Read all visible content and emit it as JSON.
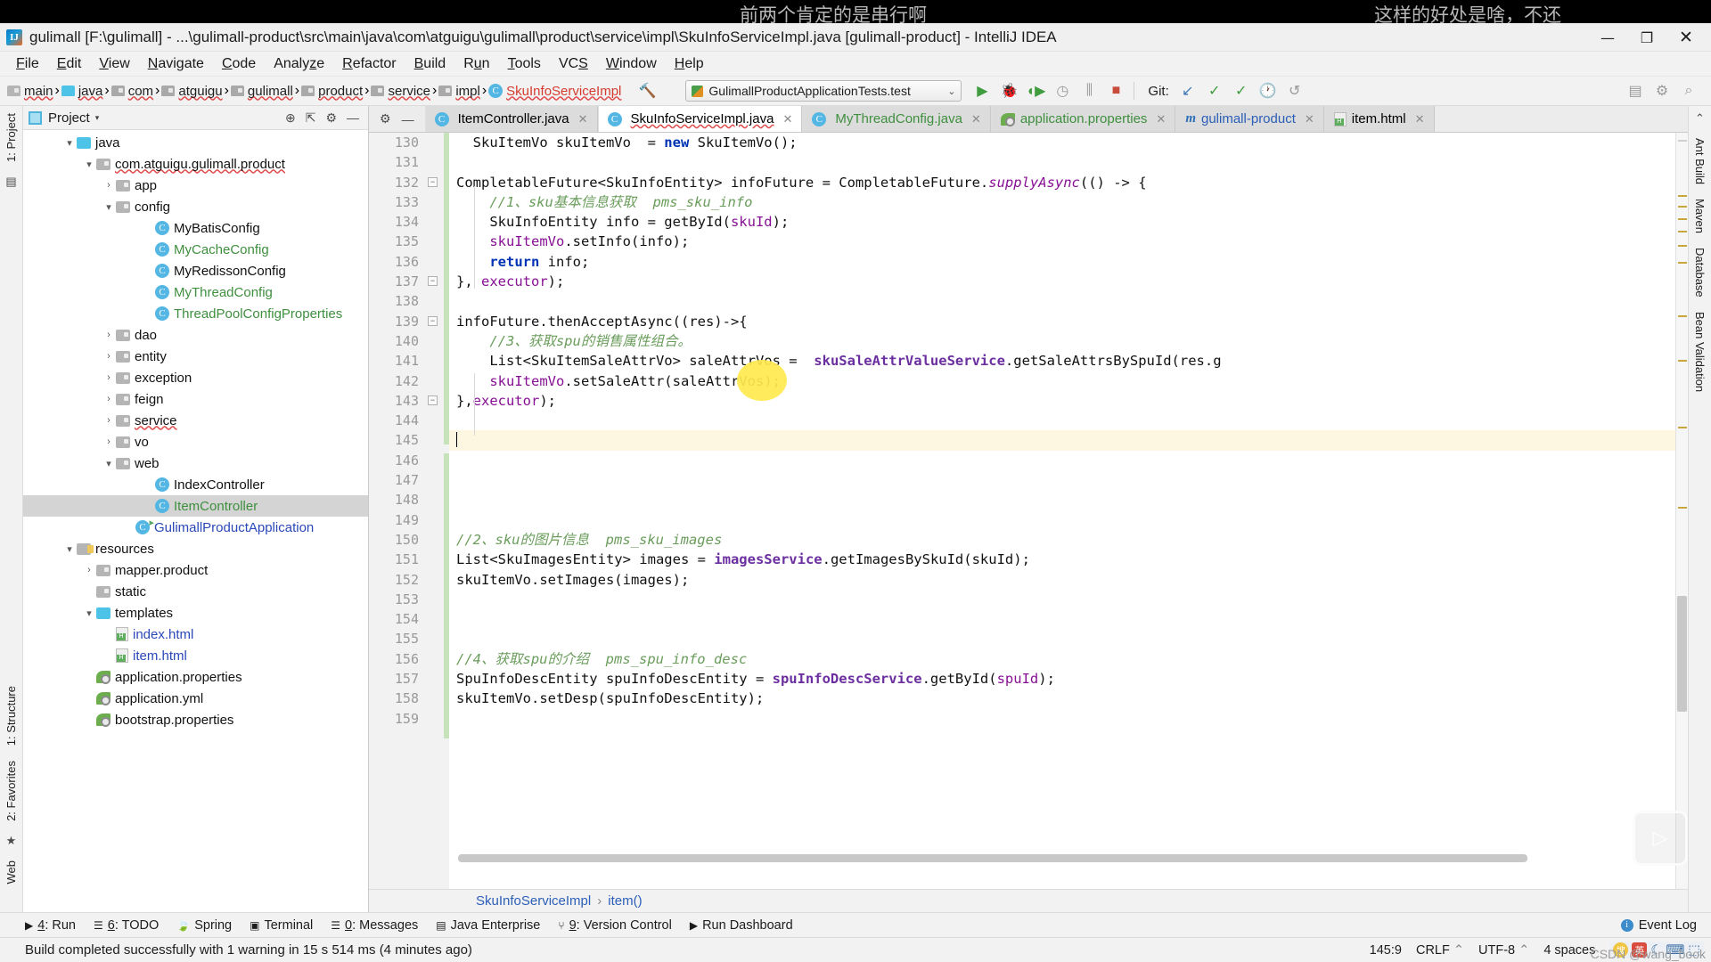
{
  "overlay": {
    "caption_left": "前两个肯定的是串行啊",
    "caption_right": "这样的好处是啥，不还",
    "watermark": "CSDN @wang_book",
    "play_icon": "play-triangle-icon"
  },
  "window": {
    "title": "gulimall [F:\\gulimall] - ...\\gulimall-product\\src\\main\\java\\com\\atguigu\\gulimall\\product\\service\\impl\\SkuInfoServiceImpl.java [gulimall-product] - IntelliJ IDEA",
    "logo": "IJ",
    "minimize": "—",
    "maximize": "❐",
    "close": "✕"
  },
  "menu": [
    {
      "pre": "",
      "mn": "F",
      "post": "ile"
    },
    {
      "pre": "",
      "mn": "E",
      "post": "dit"
    },
    {
      "pre": "",
      "mn": "V",
      "post": "iew"
    },
    {
      "pre": "",
      "mn": "N",
      "post": "avigate"
    },
    {
      "pre": "",
      "mn": "C",
      "post": "ode"
    },
    {
      "pre": "Analy",
      "mn": "z",
      "post": "e"
    },
    {
      "pre": "",
      "mn": "R",
      "post": "efactor"
    },
    {
      "pre": "",
      "mn": "B",
      "post": "uild"
    },
    {
      "pre": "R",
      "mn": "u",
      "post": "n"
    },
    {
      "pre": "",
      "mn": "T",
      "post": "ools"
    },
    {
      "pre": "VC",
      "mn": "S",
      "post": ""
    },
    {
      "pre": "",
      "mn": "W",
      "post": "indow"
    },
    {
      "pre": "",
      "mn": "H",
      "post": "elp"
    }
  ],
  "navbar": {
    "breadcrumbs": [
      {
        "label": "main",
        "icon": "folder-icon",
        "kind": "folder-gray"
      },
      {
        "label": "java",
        "icon": "folder-icon",
        "kind": "folder-blue"
      },
      {
        "label": "com",
        "icon": "package-icon",
        "kind": "folder-gray2"
      },
      {
        "label": "atguigu",
        "icon": "package-icon",
        "kind": "folder-gray2"
      },
      {
        "label": "gulimall",
        "icon": "package-icon",
        "kind": "folder-gray2"
      },
      {
        "label": "product",
        "icon": "package-icon",
        "kind": "folder-gray2"
      },
      {
        "label": "service",
        "icon": "package-icon",
        "kind": "folder-gray2"
      },
      {
        "label": "impl",
        "icon": "package-icon",
        "kind": "folder-gray2"
      },
      {
        "label": "SkuInfoServiceImpl",
        "icon": "class-icon",
        "kind": "class"
      }
    ],
    "build_icon": "hammer-icon",
    "run_config": "GulimallProductApplicationTests.test",
    "run_config_chevron": "⌄",
    "icons": [
      {
        "name": "run-icon",
        "glyph": "▶",
        "color": "green"
      },
      {
        "name": "debug-icon",
        "glyph": "🐞",
        "color": "green"
      },
      {
        "name": "run-with-coverage-icon",
        "glyph": "◖▶",
        "color": "green"
      },
      {
        "name": "profile-icon",
        "glyph": "◷",
        "color": "gray"
      },
      {
        "name": "attach-process-icon",
        "glyph": "⫼",
        "color": "gray"
      },
      {
        "name": "stop-icon",
        "glyph": "■",
        "color": "red"
      }
    ],
    "git_label": "Git:",
    "git_icons": [
      {
        "name": "update-project-icon",
        "glyph": "↙",
        "color": "blue"
      },
      {
        "name": "commit-icon",
        "glyph": "✓",
        "color": "green"
      },
      {
        "name": "push-icon",
        "glyph": "✓",
        "color": "green"
      },
      {
        "name": "history-icon",
        "glyph": "🕐",
        "color": "gray"
      },
      {
        "name": "rollback-icon",
        "glyph": "↺",
        "color": "gray"
      }
    ],
    "right_icons": [
      {
        "name": "project-structure-icon",
        "glyph": "▤"
      },
      {
        "name": "settings-icon",
        "glyph": "⚙"
      },
      {
        "name": "search-everywhere-icon",
        "glyph": "⌕"
      }
    ]
  },
  "left_rail": [
    {
      "label": "1: Project",
      "name": "rail-tab-project"
    },
    {
      "label": "1: Structure",
      "name": "rail-tab-structure"
    },
    {
      "label": "2: Favorites",
      "name": "rail-tab-favorites"
    },
    {
      "label": "Web",
      "name": "rail-tab-web"
    }
  ],
  "right_rail": [
    {
      "label": "Ant Build",
      "name": "rail-tab-ant-build"
    },
    {
      "label": "Maven",
      "name": "rail-tab-maven"
    },
    {
      "label": "Database",
      "name": "rail-tab-database"
    },
    {
      "label": "Bean Validation",
      "name": "rail-tab-bean-validation"
    }
  ],
  "project_panel": {
    "title": "Project",
    "caret": "▾",
    "actions": [
      {
        "name": "locate-icon",
        "glyph": "⊕"
      },
      {
        "name": "collapse-all-icon",
        "glyph": "⇱"
      },
      {
        "name": "settings-gear-icon",
        "glyph": "⚙"
      },
      {
        "name": "hide-icon",
        "glyph": "—"
      }
    ],
    "tree": [
      {
        "indent": 2,
        "arrow": "▾",
        "icon": "folder-blue",
        "label": "java",
        "color": "dark",
        "selected": false
      },
      {
        "indent": 3,
        "arrow": "▾",
        "icon": "package",
        "label": "com.atguigu.gulimall.product",
        "color": "dark",
        "selected": false,
        "spell": true
      },
      {
        "indent": 4,
        "arrow": "›",
        "icon": "package",
        "label": "app",
        "color": "dark",
        "selected": false
      },
      {
        "indent": 4,
        "arrow": "▾",
        "icon": "package",
        "label": "config",
        "color": "dark",
        "selected": false
      },
      {
        "indent": 6,
        "arrow": "",
        "icon": "class",
        "label": "MyBatisConfig",
        "color": "dark",
        "selected": false
      },
      {
        "indent": 6,
        "arrow": "",
        "icon": "class",
        "label": "MyCacheConfig",
        "color": "green",
        "selected": false
      },
      {
        "indent": 6,
        "arrow": "",
        "icon": "class",
        "label": "MyRedissonConfig",
        "color": "dark",
        "selected": false
      },
      {
        "indent": 6,
        "arrow": "",
        "icon": "class",
        "label": "MyThreadConfig",
        "color": "green",
        "selected": false
      },
      {
        "indent": 6,
        "arrow": "",
        "icon": "class",
        "label": "ThreadPoolConfigProperties",
        "color": "green",
        "selected": false
      },
      {
        "indent": 4,
        "arrow": "›",
        "icon": "package",
        "label": "dao",
        "color": "dark",
        "selected": false
      },
      {
        "indent": 4,
        "arrow": "›",
        "icon": "package",
        "label": "entity",
        "color": "dark",
        "selected": false
      },
      {
        "indent": 4,
        "arrow": "›",
        "icon": "package",
        "label": "exception",
        "color": "dark",
        "selected": false
      },
      {
        "indent": 4,
        "arrow": "›",
        "icon": "package",
        "label": "feign",
        "color": "dark",
        "selected": false
      },
      {
        "indent": 4,
        "arrow": "›",
        "icon": "package",
        "label": "service",
        "color": "dark",
        "selected": false,
        "spell": true
      },
      {
        "indent": 4,
        "arrow": "›",
        "icon": "package",
        "label": "vo",
        "color": "dark",
        "selected": false
      },
      {
        "indent": 4,
        "arrow": "▾",
        "icon": "package",
        "label": "web",
        "color": "dark",
        "selected": false
      },
      {
        "indent": 6,
        "arrow": "",
        "icon": "class",
        "label": "IndexController",
        "color": "dark",
        "selected": false
      },
      {
        "indent": 6,
        "arrow": "",
        "icon": "class",
        "label": "ItemController",
        "color": "green",
        "selected": true
      },
      {
        "indent": 5,
        "arrow": "",
        "icon": "class-runnable",
        "label": "GulimallProductApplication",
        "color": "blue",
        "selected": false
      },
      {
        "indent": 2,
        "arrow": "▾",
        "icon": "resources",
        "label": "resources",
        "color": "dark",
        "selected": false
      },
      {
        "indent": 3,
        "arrow": "›",
        "icon": "package",
        "label": "mapper.product",
        "color": "dark",
        "selected": false
      },
      {
        "indent": 3,
        "arrow": "",
        "icon": "package",
        "label": "static",
        "color": "dark",
        "selected": false
      },
      {
        "indent": 3,
        "arrow": "▾",
        "icon": "folder-blue-small",
        "label": "templates",
        "color": "dark",
        "selected": false
      },
      {
        "indent": 4,
        "arrow": "",
        "icon": "html",
        "label": "index.html",
        "color": "blue",
        "selected": false
      },
      {
        "indent": 4,
        "arrow": "",
        "icon": "html",
        "label": "item.html",
        "color": "blue",
        "selected": false
      },
      {
        "indent": 3,
        "arrow": "",
        "icon": "properties",
        "label": "application.properties",
        "color": "dark",
        "selected": false
      },
      {
        "indent": 3,
        "arrow": "",
        "icon": "properties",
        "label": "application.yml",
        "color": "dark",
        "selected": false
      },
      {
        "indent": 3,
        "arrow": "",
        "icon": "properties",
        "label": "bootstrap.properties",
        "color": "dark",
        "selected": false
      }
    ]
  },
  "editor": {
    "tools": [
      {
        "name": "settings-gear-icon",
        "glyph": "⚙"
      },
      {
        "name": "hide-panel-icon",
        "glyph": "—"
      }
    ],
    "tabs": [
      {
        "label": "ItemController.java",
        "icon": "java-class-icon",
        "active": false,
        "closable": true,
        "color": "dark"
      },
      {
        "label": "SkuInfoServiceImpl.java",
        "icon": "java-class-icon",
        "active": true,
        "closable": true,
        "color": "dark",
        "spell": true
      },
      {
        "label": "MyThreadConfig.java",
        "icon": "java-class-icon",
        "active": false,
        "closable": true,
        "color": "green"
      },
      {
        "label": "application.properties",
        "icon": "properties-icon",
        "active": false,
        "closable": true,
        "color": "green"
      },
      {
        "label": "gulimall-product",
        "icon": "maven-icon",
        "active": false,
        "closable": true,
        "color": "blue"
      },
      {
        "label": "item.html",
        "icon": "html-icon",
        "active": false,
        "closable": true,
        "color": "dark"
      }
    ],
    "first_line_number": 130,
    "lines": [
      {
        "n": 130,
        "marks": "",
        "fold": "",
        "html": "<span class=\"plain\">  SkuItemVo skuItemVo  = </span><span class=\"kw\">new</span><span class=\"plain\"> SkuItemVo();</span>",
        "partial": true
      },
      {
        "n": 131,
        "marks": "",
        "fold": "",
        "html": ""
      },
      {
        "n": 132,
        "marks": "lambda",
        "fold": "minus",
        "html": "<span class=\"plain\">CompletableFuture&lt;SkuInfoEntity&gt; infoFuture = CompletableFuture.</span><span class=\"stat\">supplyAsync</span><span class=\"plain\">(() -&gt; {</span>"
      },
      {
        "n": 133,
        "marks": "",
        "fold": "",
        "html": "<span class=\"cmt-green\">    //1、sku基本信息获取  pms_sku_info</span>"
      },
      {
        "n": 134,
        "marks": "",
        "fold": "",
        "html": "<span class=\"plain\">    SkuInfoEntity info = getById(</span><span class=\"fld\">skuId</span><span class=\"plain\">);</span>"
      },
      {
        "n": 135,
        "marks": "",
        "fold": "",
        "html": "<span class=\"fld\">    skuItemVo</span><span class=\"plain\">.setInfo(info);</span>"
      },
      {
        "n": 136,
        "marks": "",
        "fold": "",
        "html": "<span class=\"kw\">    return</span><span class=\"plain\"> info;</span>"
      },
      {
        "n": 137,
        "marks": "",
        "fold": "minus",
        "html": "<span class=\"plain\">}, </span><span class=\"fld\">executor</span><span class=\"plain\">);</span>"
      },
      {
        "n": 138,
        "marks": "",
        "fold": "",
        "html": ""
      },
      {
        "n": 139,
        "marks": "lambda",
        "fold": "minus",
        "html": "<span class=\"plain\">infoFuture.thenAcceptAsync((res)-&gt;{</span>"
      },
      {
        "n": 140,
        "marks": "",
        "fold": "",
        "html": "<span class=\"cmt-green\">    //3、获取spu的销售属性组合。</span>"
      },
      {
        "n": 141,
        "marks": "",
        "fold": "",
        "html": "<span class=\"plain\">    List&lt;SkuItemSaleAttrVo&gt; saleAttrVos =  </span><span class=\"svc\">skuSaleAttrValueService</span><span class=\"plain\">.getSaleAttrsBySpuId(res.g</span>"
      },
      {
        "n": 142,
        "marks": "",
        "fold": "",
        "html": "<span class=\"fld\">    skuItemVo</span><span class=\"plain\">.setSaleAttr(saleAttrVos);</span>"
      },
      {
        "n": 143,
        "marks": "",
        "fold": "minus",
        "html": "<span class=\"plain\">},</span><span class=\"fld\">executor</span><span class=\"plain\">);</span>"
      },
      {
        "n": 144,
        "marks": "",
        "fold": "",
        "html": ""
      },
      {
        "n": 145,
        "marks": "",
        "fold": "",
        "html": "<span class=\"caret\"></span>",
        "caret": true
      },
      {
        "n": 146,
        "marks": "",
        "fold": "",
        "html": ""
      },
      {
        "n": 147,
        "marks": "",
        "fold": "",
        "html": ""
      },
      {
        "n": 148,
        "marks": "",
        "fold": "",
        "html": ""
      },
      {
        "n": 149,
        "marks": "",
        "fold": "",
        "html": ""
      },
      {
        "n": 150,
        "marks": "",
        "fold": "",
        "html": "<span class=\"cmt-green\">//2、sku的图片信息  pms_sku_images</span>"
      },
      {
        "n": 151,
        "marks": "",
        "fold": "",
        "html": "<span class=\"plain\">List&lt;SkuImagesEntity&gt; images = </span><span class=\"svc\">imagesService</span><span class=\"plain\">.getImagesBySkuId(skuId);</span>"
      },
      {
        "n": 152,
        "marks": "",
        "fold": "",
        "html": "<span class=\"plain\">skuItemVo.setImages(images);</span>"
      },
      {
        "n": 153,
        "marks": "",
        "fold": "",
        "html": ""
      },
      {
        "n": 154,
        "marks": "",
        "fold": "",
        "html": ""
      },
      {
        "n": 155,
        "marks": "",
        "fold": "",
        "html": ""
      },
      {
        "n": 156,
        "marks": "",
        "fold": "",
        "html": "<span class=\"cmt-green\">//4、获取spu的介绍  pms_spu_info_desc</span>"
      },
      {
        "n": 157,
        "marks": "",
        "fold": "",
        "html": "<span class=\"plain\">SpuInfoDescEntity spuInfoDescEntity = </span><span class=\"svc\">spuInfoDescService</span><span class=\"plain\">.getById(</span><span class=\"fld\">spuId</span><span class=\"plain\">);</span>"
      },
      {
        "n": 158,
        "marks": "",
        "fold": "",
        "html": "<span class=\"plain\">skuItemVo.setDesp(spuInfoDescEntity);</span>"
      },
      {
        "n": 159,
        "marks": "",
        "fold": "",
        "html": ""
      }
    ],
    "breadcrumb": [
      {
        "label": "SkuInfoServiceImpl"
      },
      {
        "label": "item()"
      }
    ],
    "breadcrumb_sep": "›"
  },
  "bottom_toolwindows": [
    {
      "glyph": "▶",
      "pre": "",
      "u": "4",
      "post": ": Run",
      "name": "tool-run"
    },
    {
      "glyph": "☰",
      "pre": "",
      "u": "6",
      "post": ": TODO",
      "name": "tool-todo"
    },
    {
      "glyph": "🍃",
      "pre": "",
      "u": "",
      "post": "Spring",
      "name": "tool-spring"
    },
    {
      "glyph": "▣",
      "pre": "",
      "u": "",
      "post": "Terminal",
      "name": "tool-terminal"
    },
    {
      "glyph": "☰",
      "pre": "",
      "u": "0",
      "post": ": Messages",
      "name": "tool-messages"
    },
    {
      "glyph": "▤",
      "pre": "",
      "u": "",
      "post": "Java Enterprise",
      "name": "tool-java-enterprise"
    },
    {
      "glyph": "⑂",
      "pre": "",
      "u": "9",
      "post": ": Version Control",
      "name": "tool-version-control"
    },
    {
      "glyph": "▶",
      "pre": "",
      "u": "",
      "post": "Run Dashboard",
      "name": "tool-run-dashboard"
    }
  ],
  "event_log": {
    "label": "Event Log",
    "badge": "i"
  },
  "statusbar": {
    "message": "Build completed successfully with 1 warning in 15 s 514 ms (4 minutes ago)",
    "caret_position": "145:9",
    "line_separator": "CRLF",
    "line_separator_caret": "⌃",
    "encoding": "UTF-8",
    "encoding_caret": "⌃",
    "indent": "4 spaces",
    "ime": {
      "logo": "搜",
      "lang": "英",
      "items": [
        "☾",
        "⌨",
        "⬚"
      ]
    }
  },
  "colors": {
    "accent_blue": "#2b5fb8",
    "keyword_blue": "#0033b3",
    "comment_green": "#6a9d5c",
    "field_purple": "#871094",
    "service_purple": "#6b2fa0",
    "selection_yellow": "#ffe94d",
    "caret_line": "#fdf7e2",
    "selected_row": "#d4d4d4",
    "changed_marker_green": "#c6e3bb"
  }
}
